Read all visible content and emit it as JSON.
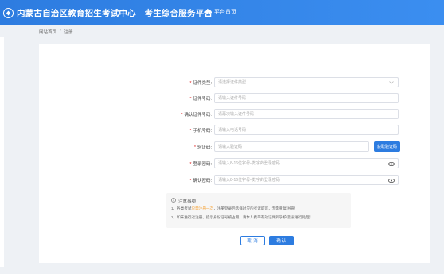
{
  "header": {
    "site_title": "内蒙古自治区教育招生考试中心—考生综合服务平台",
    "home_label": "平台首页"
  },
  "breadcrumb": {
    "home": "网站首页",
    "separator": "/",
    "current": "注册"
  },
  "form": {
    "rows": [
      {
        "label": "证件类型:",
        "placeholder": "请选择证件类型",
        "type": "select"
      },
      {
        "label": "证件号码:",
        "placeholder": "请输入证件号码",
        "type": "text"
      },
      {
        "label": "确认证件号码:",
        "placeholder": "请再次输入证件号码",
        "type": "text"
      },
      {
        "label": "手机号码:",
        "placeholder": "请输入电话号码",
        "type": "text"
      },
      {
        "label": "验证码:",
        "placeholder": "请输入验证码",
        "type": "code"
      },
      {
        "label": "登录密码:",
        "placeholder": "请输入8-16位字母+数字的登录密码",
        "type": "password"
      },
      {
        "label": "确认密码:",
        "placeholder": "请输入8-16位字母+数字的登录密码",
        "type": "password"
      }
    ],
    "required_mark": "*",
    "code_button": "获取验证码"
  },
  "notice": {
    "title": "注意事项",
    "line1_pre": "1、各类考试",
    "line1_highlight": "只需注册一次",
    "line1_post": "，注册登录后选择对应的考试即可，无需重复注册！",
    "line2": "2、如未进行过注册，提示身份证号被占用，请本人携带有效证件到学校/旗县进行处理！"
  },
  "buttons": {
    "cancel": "取 消",
    "confirm": "确 认"
  },
  "colors": {
    "primary": "#2d7ce0",
    "required": "#e02020",
    "highlight": "#f59a23"
  }
}
